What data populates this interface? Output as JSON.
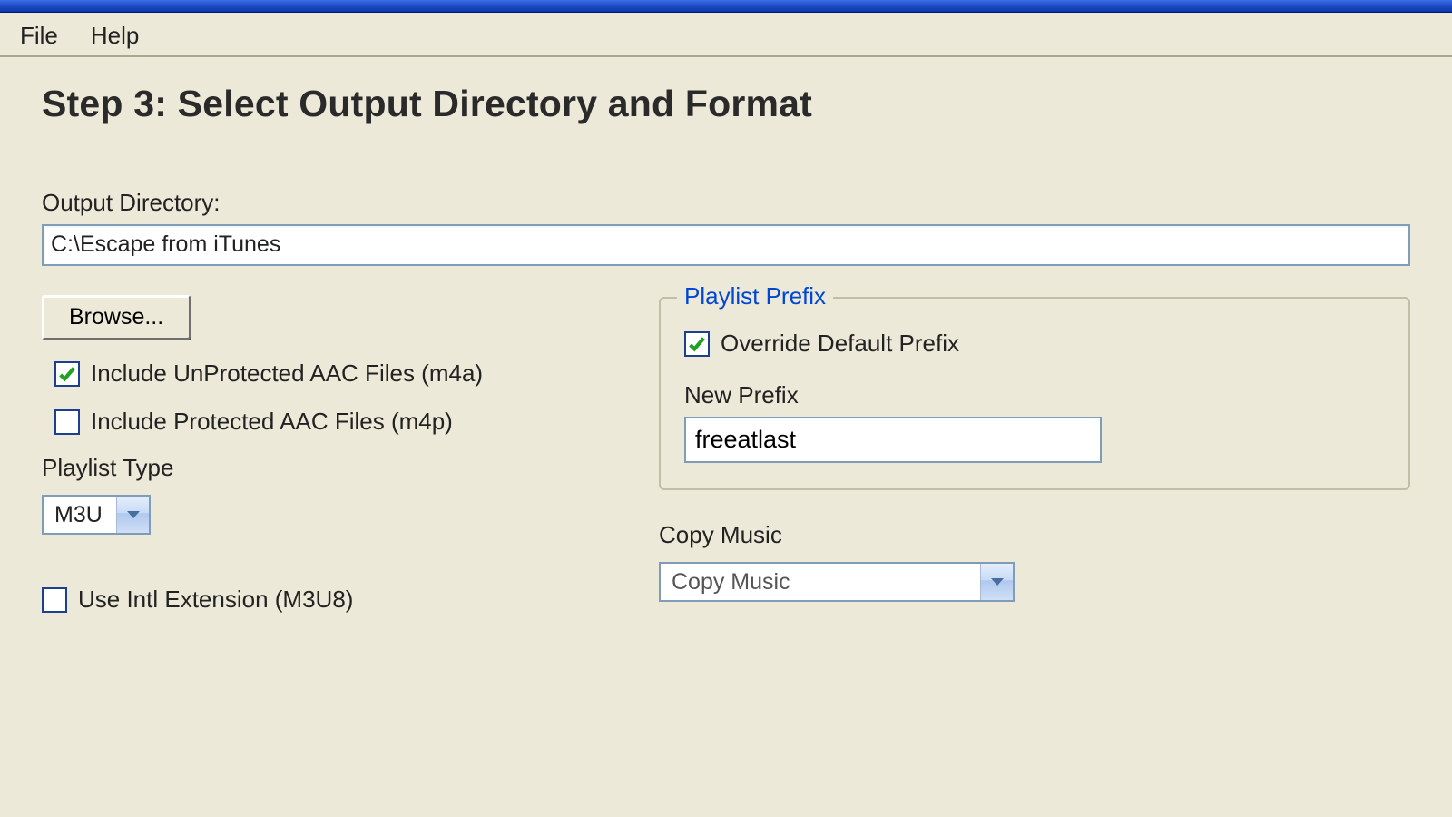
{
  "menu": {
    "file": "File",
    "help": "Help"
  },
  "heading": "Step 3: Select Output Directory and Format",
  "output_dir": {
    "label": "Output Directory:",
    "value": "C:\\Escape from iTunes",
    "browse": "Browse..."
  },
  "checkboxes": {
    "include_unprotected": {
      "label": "Include UnProtected AAC Files (m4a)",
      "checked": true
    },
    "include_protected": {
      "label": "Include Protected AAC Files (m4p)",
      "checked": false
    },
    "use_intl": {
      "label": "Use Intl Extension (M3U8)",
      "checked": false
    }
  },
  "playlist_type": {
    "label": "Playlist Type",
    "value": "M3U"
  },
  "prefix_group": {
    "legend": "Playlist Prefix",
    "override": {
      "label": "Override Default Prefix",
      "checked": true
    },
    "new_prefix_label": "New Prefix",
    "new_prefix_value": "freeatlast"
  },
  "copy_music": {
    "label": "Copy Music",
    "value": "Copy Music"
  }
}
